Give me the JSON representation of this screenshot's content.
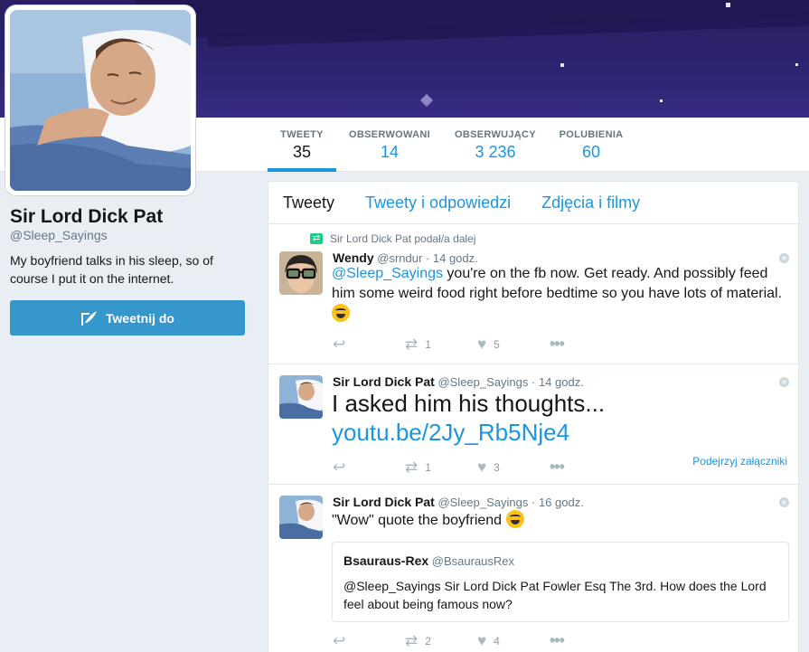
{
  "profile": {
    "name": "Sir Lord Dick Pat",
    "handle": "@Sleep_Sayings",
    "bio": "My boyfriend talks in his sleep, so of course I put it on the internet.",
    "tweet_button": "Tweetnij do"
  },
  "stats": [
    {
      "label": "TWEETY",
      "value": "35"
    },
    {
      "label": "OBSERWOWANI",
      "value": "14"
    },
    {
      "label": "OBSERWUJĄCY",
      "value": "3 236"
    },
    {
      "label": "POLUBIENIA",
      "value": "60"
    }
  ],
  "tabs": [
    "Tweety",
    "Tweety i odpowiedzi",
    "Zdjęcia i filmy"
  ],
  "tweets": [
    {
      "retweet_context": "Sir Lord Dick Pat podał/a dalej",
      "author": "Wendy",
      "handle": "@srndur",
      "time": "· 14 godz.",
      "mention": "@Sleep_Sayings",
      "text": " you're on the fb now. Get ready. And possibly feed him some weird food right before bedtime so you have lots of material.",
      "retweets": "1",
      "likes": "5"
    },
    {
      "author": "Sir Lord Dick Pat",
      "handle": "@Sleep_Sayings",
      "time": "· 14 godz.",
      "text": "I asked him his thoughts...",
      "link": "youtu.be/2Jy_Rb5Nje4",
      "attachment": "Podejrzyj załączniki",
      "retweets": "1",
      "likes": "3"
    },
    {
      "author": "Sir Lord Dick Pat",
      "handle": "@Sleep_Sayings",
      "time": "· 16 godz.",
      "text": "\"Wow\" quote the boyfriend ",
      "quote": {
        "author": "Bsauraus-Rex",
        "handle": "@BsaurausRex",
        "text": "@Sleep_Sayings Sir Lord Dick Pat Fowler Esq The 3rd. How does the Lord feel about being famous now?"
      },
      "retweets": "2",
      "likes": "4"
    }
  ],
  "colors": {
    "accent": "#1b95e0",
    "button": "#3597cc",
    "retweet": "#19cf86"
  }
}
